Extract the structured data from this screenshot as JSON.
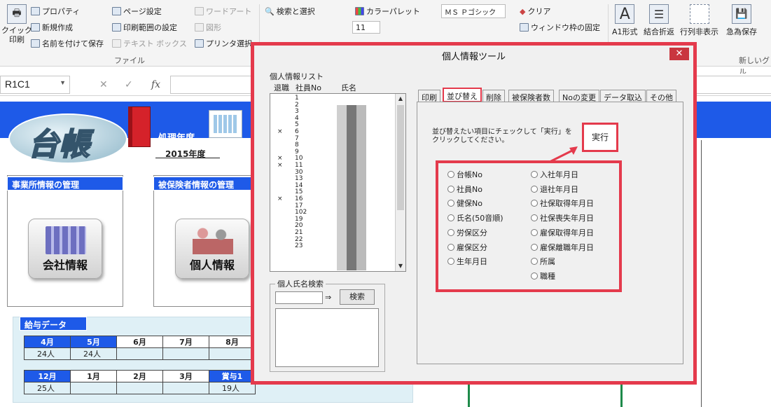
{
  "ribbon": {
    "quick_print": "クイック\n印刷",
    "properties": "プロパティ",
    "new": "新規作成",
    "save_as": "名前を付けて保存",
    "page_setup": "ページ設定",
    "print_area": "印刷範囲の設定",
    "text_box": "テキスト ボックス",
    "word_art": "ワードアート",
    "shapes": "図形",
    "printer_select": "プリンタ選択",
    "find_select": "検索と選択",
    "color_palette": "カラーパレット",
    "font_name": "ＭＳ Ｐゴシック",
    "font_size": "11",
    "clear": "クリア",
    "freeze": "ウィンドウ枠の固定",
    "a1_format": "A1形式",
    "merge_wrap": "結合折返",
    "hide_rows_cols": "行列非表示",
    "quick_save": "急為保存",
    "group_file": "ファイル",
    "group_new": "新しいグル"
  },
  "formula_bar": {
    "name_box": "R1C1",
    "fx": "fx"
  },
  "sheet": {
    "logo": "台帳",
    "fiscal_label": "処理年度",
    "fiscal_year": "2015年度",
    "company_section": "事業所情報の管理",
    "insured_section": "被保険者情報の管理",
    "company_info": "会社情報",
    "personal_info": "個人情報",
    "salary_section": "給与データ",
    "months1": [
      "4月",
      "5月",
      "6月",
      "7月",
      "8月"
    ],
    "counts1": [
      "24人",
      "24人",
      "",
      "",
      ""
    ],
    "months2": [
      "12月",
      "1月",
      "2月",
      "3月",
      "賞与1"
    ],
    "counts2": [
      "25人",
      "",
      "",
      "",
      "19人"
    ]
  },
  "dialog": {
    "title": "個人情報ツール",
    "close": "✕",
    "list_label": "個人情報リスト",
    "col_retired": "退職",
    "col_empno": "社員No",
    "col_name": "氏名",
    "rows": [
      {
        "mark": "",
        "no": "1"
      },
      {
        "mark": "",
        "no": "2"
      },
      {
        "mark": "",
        "no": "3"
      },
      {
        "mark": "",
        "no": "4"
      },
      {
        "mark": "",
        "no": "5"
      },
      {
        "mark": "×",
        "no": "6"
      },
      {
        "mark": "",
        "no": "7"
      },
      {
        "mark": "",
        "no": "8"
      },
      {
        "mark": "",
        "no": "9"
      },
      {
        "mark": "×",
        "no": "10"
      },
      {
        "mark": "×",
        "no": "11"
      },
      {
        "mark": "",
        "no": "30"
      },
      {
        "mark": "",
        "no": "13"
      },
      {
        "mark": "",
        "no": "14"
      },
      {
        "mark": "",
        "no": "15"
      },
      {
        "mark": "×",
        "no": "16"
      },
      {
        "mark": "",
        "no": "17"
      },
      {
        "mark": "",
        "no": "102"
      },
      {
        "mark": "",
        "no": "19"
      },
      {
        "mark": "",
        "no": "20"
      },
      {
        "mark": "",
        "no": "21"
      },
      {
        "mark": "",
        "no": "22"
      },
      {
        "mark": "",
        "no": "23"
      }
    ],
    "search_label": "個人氏名検索",
    "search_arrow": "⇒",
    "search_button": "検索",
    "tabs": [
      "印刷",
      "並び替え",
      "削除",
      "被保険者数",
      "Noの変更",
      "データ取込",
      "その他"
    ],
    "instructions": "並び替えたい項目にチェックして「実行」を\nクリックしてください。",
    "exec_button": "実行",
    "options_left": [
      "台帳No",
      "社員No",
      "健保No",
      "氏名(50音順)",
      "労保区分",
      "雇保区分",
      "生年月日"
    ],
    "options_right": [
      "入社年月日",
      "退社年月日",
      "社保取得年月日",
      "社保喪失年月日",
      "雇保取得年月日",
      "雇保離職年月日",
      "所属",
      "職種"
    ]
  }
}
